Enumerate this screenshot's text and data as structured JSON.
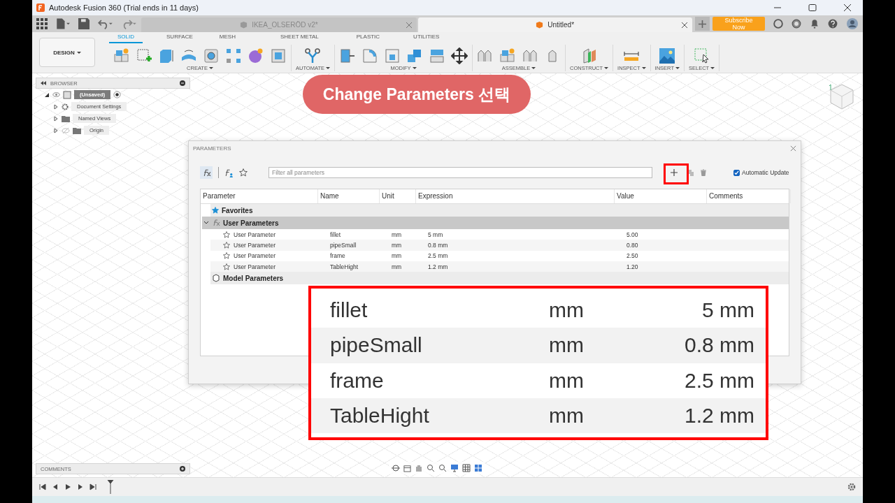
{
  "window": {
    "title": "Autodesk Fusion 360 (Trial ends in 11 days)"
  },
  "document_tabs": [
    {
      "label": "IKEA_OLSERÖD v2*",
      "selected": false
    },
    {
      "label": "Untitled*",
      "selected": true
    }
  ],
  "subscribe_button": "Subscribe Now",
  "workspace_button": "DESIGN",
  "toolbar_tabs": [
    {
      "label": "SOLID",
      "selected": true
    },
    {
      "label": "SURFACE",
      "selected": false
    },
    {
      "label": "MESH",
      "selected": false
    },
    {
      "label": "SHEET METAL",
      "selected": false
    },
    {
      "label": "PLASTIC",
      "selected": false
    },
    {
      "label": "UTILITIES",
      "selected": false
    }
  ],
  "toolbar_groups": [
    {
      "kind": "create",
      "label": "CREATE"
    },
    {
      "kind": "automate",
      "label": "AUTOMATE"
    },
    {
      "kind": "modify",
      "label": "MODIFY"
    },
    {
      "kind": "assemble",
      "label": "ASSEMBLE"
    },
    {
      "kind": "construct",
      "label": "CONSTRUCT"
    },
    {
      "kind": "inspect",
      "label": "INSPECT"
    },
    {
      "kind": "insert",
      "label": "INSERT"
    },
    {
      "kind": "select",
      "label": "SELECT"
    }
  ],
  "browser": {
    "title": "BROWSER",
    "items": [
      {
        "label": "(Unsaved)",
        "kind": "component",
        "expanded": true,
        "children": [
          {
            "label": "Document Settings",
            "kind": "settings",
            "expanded": false
          },
          {
            "label": "Named Views",
            "kind": "folder",
            "expanded": false
          },
          {
            "label": "Origin",
            "kind": "hidden-folder",
            "expanded": false
          }
        ]
      }
    ]
  },
  "comments_panel": {
    "title": "COMMENTS"
  },
  "annotation": {
    "text": "Change Parameters 선택"
  },
  "dialog": {
    "title": "PARAMETERS",
    "filter": {
      "placeholder": "Filter all parameters"
    },
    "automatic_update": {
      "label": "Automatic Update",
      "checked": true
    },
    "columns": [
      "Parameter",
      "Name",
      "Unit",
      "Expression",
      "Value",
      "Comments"
    ],
    "groups": [
      {
        "label": "Favorites",
        "kind": "favorites",
        "expanded": false,
        "selected": false
      },
      {
        "label": "User Parameters",
        "kind": "user",
        "expanded": true,
        "selected": true,
        "rows": [
          {
            "type": "User Parameter",
            "name": "fillet",
            "unit": "mm",
            "expression": "5 mm",
            "value": "5.00",
            "favorite": false
          },
          {
            "type": "User Parameter",
            "name": "pipeSmall",
            "unit": "mm",
            "expression": "0.8 mm",
            "value": "0.80",
            "favorite": false
          },
          {
            "type": "User Parameter",
            "name": "frame",
            "unit": "mm",
            "expression": "2.5 mm",
            "value": "2.50",
            "favorite": false
          },
          {
            "type": "User Parameter",
            "name": "TableHight",
            "unit": "mm",
            "expression": "1.2 mm",
            "value": "1.20",
            "favorite": false
          }
        ]
      },
      {
        "label": "Model Parameters",
        "kind": "model",
        "expanded": false,
        "selected": false
      }
    ]
  },
  "callout": {
    "rows": [
      {
        "name": "fillet",
        "unit": "mm",
        "expression": "5 mm"
      },
      {
        "name": "pipeSmall",
        "unit": "mm",
        "expression": "0.8 mm"
      },
      {
        "name": "frame",
        "unit": "mm",
        "expression": "2.5 mm"
      },
      {
        "name": "TableHight",
        "unit": "mm",
        "expression": "1.2 mm"
      }
    ]
  }
}
